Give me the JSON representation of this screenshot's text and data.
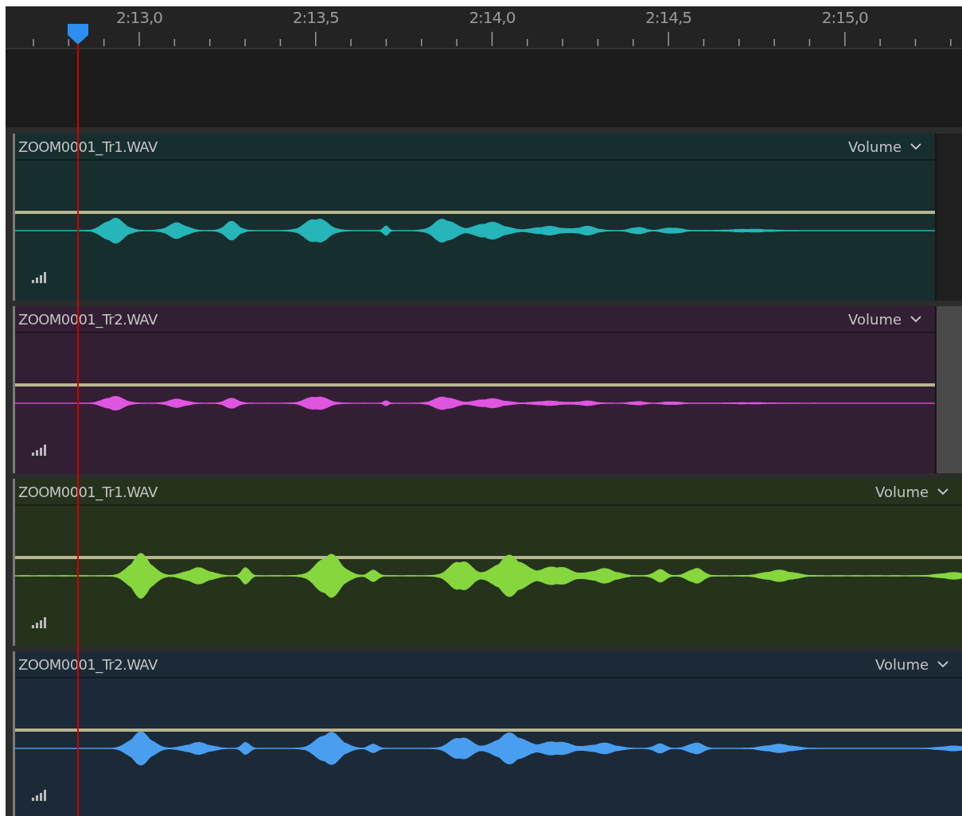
{
  "ruler": {
    "labels": [
      "2:13,0",
      "2:13,5",
      "2:14,0",
      "2:14,5",
      "2:15,0"
    ]
  },
  "tracks": [
    {
      "clip_name": "ZOOM0001_Tr1.WAV",
      "envelope": "Volume",
      "color": "#26b5b8",
      "kind": "ended"
    },
    {
      "clip_name": "ZOOM0001_Tr2.WAV",
      "envelope": "Volume",
      "color": "#e055e0",
      "kind": "highlighted"
    },
    {
      "clip_name": "ZOOM0001_Tr1.WAV",
      "envelope": "Volume",
      "color": "#86d63e",
      "kind": "full"
    },
    {
      "clip_name": "ZOOM0001_Tr2.WAV",
      "envelope": "Volume",
      "color": "#4a9ef0",
      "kind": "full"
    }
  ]
}
